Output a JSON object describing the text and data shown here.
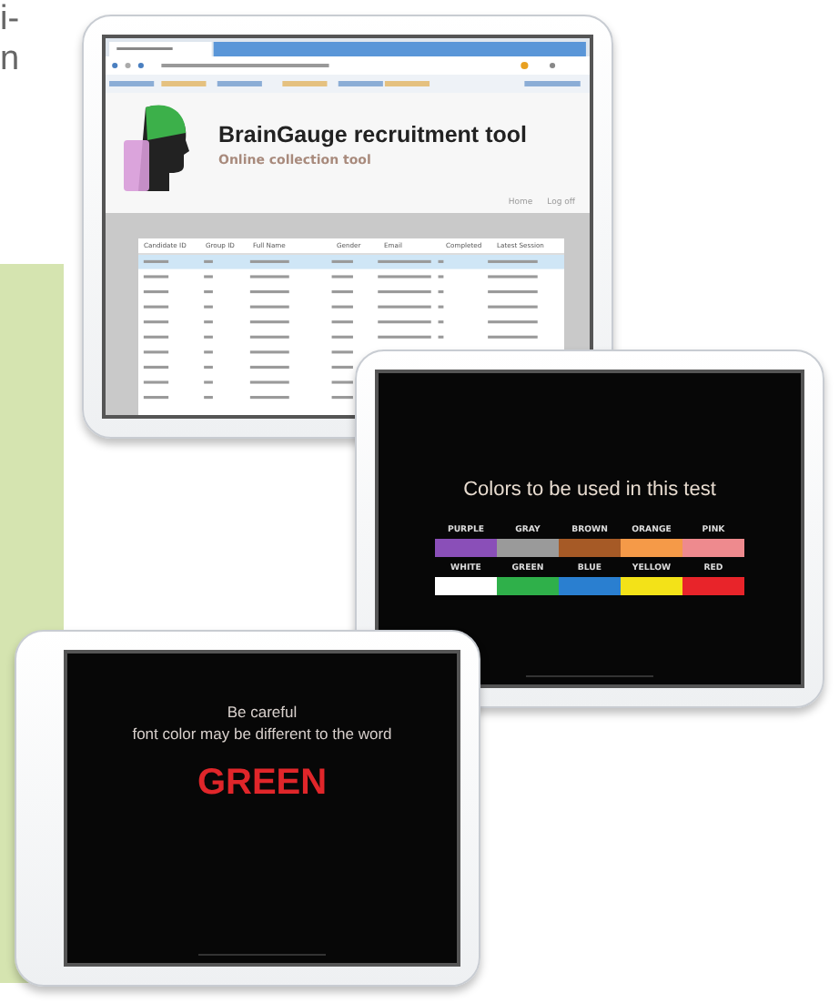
{
  "text_fragments": [
    "i-",
    "n"
  ],
  "browser": {
    "title": "BrainGauge recruitment tool",
    "subtitle": "Online collection tool",
    "links": [
      "Home",
      "Log off"
    ],
    "table": {
      "columns": [
        "Candidate ID",
        "Group ID",
        "Full Name",
        "Gender",
        "Email",
        "Completed",
        "Latest Session"
      ]
    }
  },
  "colors_screen": {
    "title": "Colors to be used in this test",
    "swatches": [
      {
        "label": "PURPLE",
        "color": "#8a4fb8"
      },
      {
        "label": "GRAY",
        "color": "#9a9a9a"
      },
      {
        "label": "BROWN",
        "color": "#a65a26"
      },
      {
        "label": "ORANGE",
        "color": "#f59a48"
      },
      {
        "label": "PINK",
        "color": "#ee8a8e"
      },
      {
        "label": "WHITE",
        "color": "#ffffff"
      },
      {
        "label": "GREEN",
        "color": "#2fb04a"
      },
      {
        "label": "BLUE",
        "color": "#2a7fd0"
      },
      {
        "label": "YELLOW",
        "color": "#f3e218"
      },
      {
        "label": "RED",
        "color": "#e8242a"
      }
    ]
  },
  "stimulus_screen": {
    "lines": [
      "Be careful",
      "font color may be different to the word"
    ],
    "word": "GREEN",
    "color": "#e0262a"
  }
}
